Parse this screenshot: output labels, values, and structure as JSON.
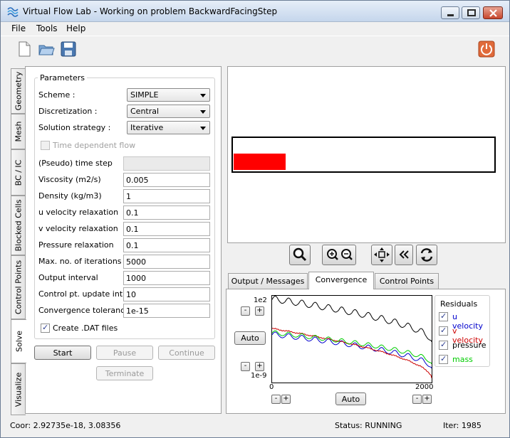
{
  "window": {
    "title": "Virtual Flow Lab - Working on problem BackwardFacingStep"
  },
  "menu": [
    "File",
    "Tools",
    "Help"
  ],
  "toolbar": {
    "icons": [
      "new-file-icon",
      "open-folder-icon",
      "save-disk-icon",
      "power-icon"
    ]
  },
  "left_tabs": [
    "Geometry",
    "Mesh",
    "BC / IC",
    "Blocked Cells",
    "Control Points",
    "Solve",
    "Visualize"
  ],
  "active_left_tab": "Solve",
  "parameters": {
    "title": "Parameters",
    "scheme_label": "Scheme :",
    "scheme_value": "SIMPLE",
    "discretization_label": "Discretization :",
    "discretization_value": "Central",
    "strategy_label": "Solution strategy :",
    "strategy_value": "Iterative",
    "time_dependent_label": "Time dependent flow",
    "time_step_label": "(Pseudo) time step",
    "time_step_value": "",
    "viscosity_label": "Viscosity (m2/s)",
    "viscosity_value": "0.005",
    "density_label": "Density (kg/m3)",
    "density_value": "1",
    "u_relax_label": "u velocity relaxation",
    "u_relax_value": "0.1",
    "v_relax_label": "v velocity relaxation",
    "v_relax_value": "0.1",
    "p_relax_label": "Pressure relaxation",
    "p_relax_value": "0.1",
    "max_iter_label": "Max. no. of iterations",
    "max_iter_value": "5000",
    "output_interval_label": "Output interval",
    "output_interval_value": "1000",
    "cp_update_label": "Control pt. update int.",
    "cp_update_value": "10",
    "tolerance_label": "Convergence tolerance",
    "tolerance_value": "1e-15"
  },
  "create_dat": {
    "label": "Create .DAT files",
    "checked": true
  },
  "buttons": {
    "start": "Start",
    "pause": "Pause",
    "continue": "Continue",
    "terminate": "Terminate"
  },
  "view_controls": [
    "zoom-icon",
    "zoom-in-icon",
    "zoom-out-icon",
    "pan-icon",
    "rewind-icon",
    "refresh-icon"
  ],
  "bottom_tabs": [
    "Output / Messages",
    "Convergence",
    "Control Points"
  ],
  "active_bottom_tab": "Convergence",
  "convergence": {
    "auto_label": "Auto",
    "minus": "-",
    "plus": "+"
  },
  "chart_data": {
    "type": "line",
    "title": "",
    "xlabel": "",
    "ylabel": "",
    "xlim": [
      0,
      2000
    ],
    "ylim_labels": [
      "1e2",
      "1e-9"
    ],
    "x_tick_labels": [
      "0",
      "2000"
    ],
    "y_scale": "log",
    "legend_title": "Residuals",
    "legend_position": "right",
    "series": [
      {
        "name": "u velocity",
        "color": "#0000cc",
        "start": 0.55,
        "end": 0.17,
        "amp": 0.035
      },
      {
        "name": "v velocity",
        "color": "#cc0000",
        "start": 0.62,
        "end": 0.06,
        "amp": 0.006
      },
      {
        "name": "pressure",
        "color": "#000000",
        "start": 0.95,
        "end": 0.47,
        "amp": 0.045
      },
      {
        "name": "mass",
        "color": "#00cc00",
        "start": 0.57,
        "end": 0.22,
        "amp": 0.03
      }
    ]
  },
  "status": {
    "coordinates": "Coor: 2.92735e-18, 3.08356",
    "state": "Status: RUNNING",
    "iteration": "Iter: 1985"
  },
  "colors": {
    "accent_red": "#ff0000",
    "power_orange": "#e06a3a"
  }
}
